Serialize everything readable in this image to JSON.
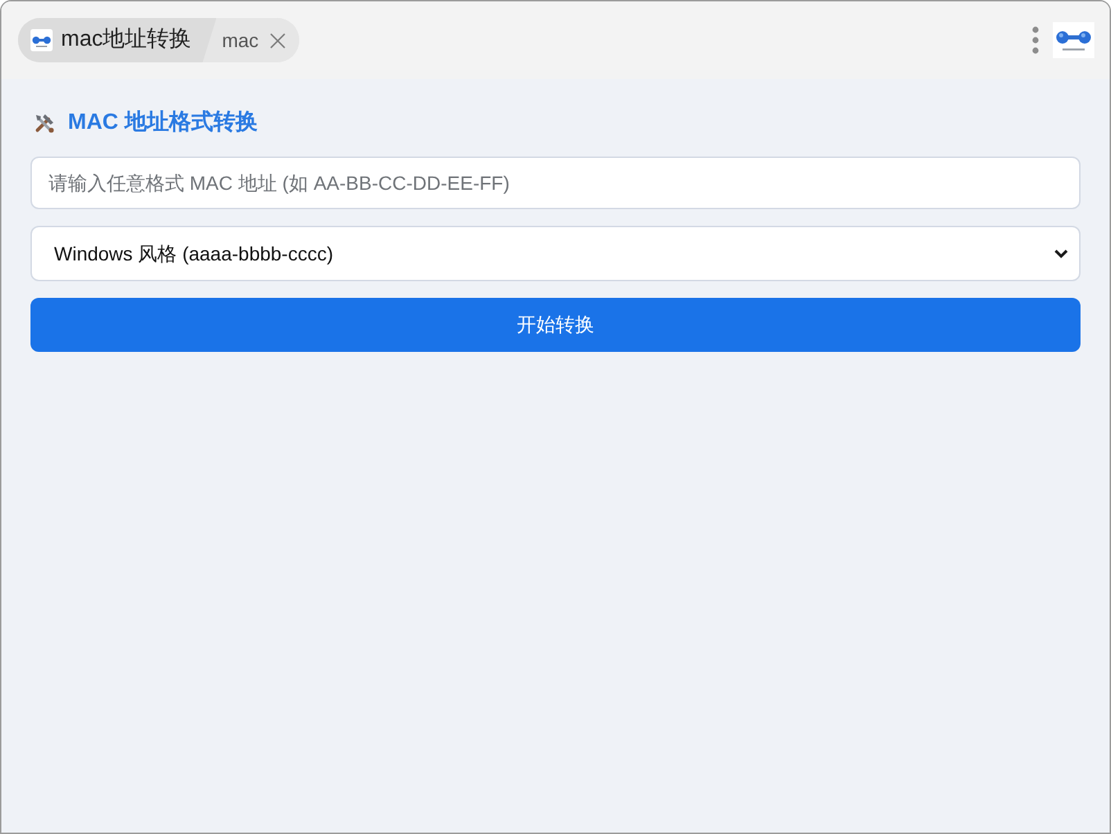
{
  "tabs": [
    {
      "kind": "app",
      "label": "mac地址转换",
      "selected": true
    },
    {
      "kind": "page",
      "label": "mac",
      "selected": false
    }
  ],
  "heading": "MAC 地址格式转换",
  "mac_input": {
    "placeholder": "请输入任意格式 MAC 地址 (如 AA-BB-CC-DD-EE-FF)"
  },
  "format_select": {
    "value": "Windows 风格 (aaaa-bbbb-cccc)"
  },
  "convert_button": "开始转换"
}
